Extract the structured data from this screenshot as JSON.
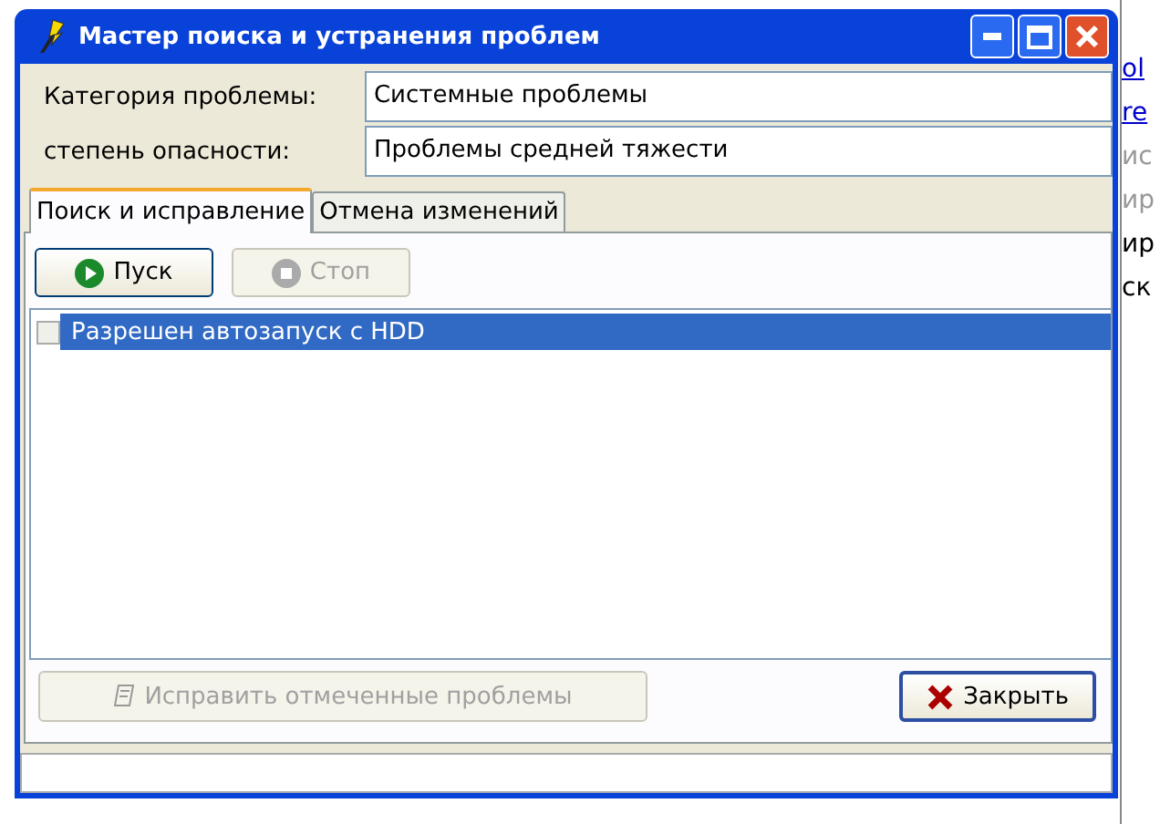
{
  "background": {
    "right_fragments": [
      {
        "text": "ol",
        "kind": "link"
      },
      {
        "text": "re",
        "kind": "link"
      },
      {
        "text": "ис",
        "kind": "grey"
      },
      {
        "text": "ир",
        "kind": "grey"
      },
      {
        "text": "ир",
        "kind": "plain"
      },
      {
        "text": "ск",
        "kind": "plain"
      }
    ]
  },
  "window": {
    "title": "Мастер поиска и устранения проблем"
  },
  "fields": [
    {
      "label": "Категория проблемы:",
      "value": "Системные проблемы"
    },
    {
      "label": "степень опасности:",
      "value": "Проблемы средней тяжести"
    }
  ],
  "tabs": [
    {
      "label": "Поиск и исправление",
      "selected": true
    },
    {
      "label": "Отмена изменений",
      "selected": false
    }
  ],
  "toolbar": [
    {
      "label": "Пуск",
      "kind": "play",
      "disabled": false
    },
    {
      "label": "Стоп",
      "kind": "stop",
      "disabled": true
    }
  ],
  "items": [
    {
      "label": "Разрешен автозапуск с HDD",
      "checked": false,
      "selected": true
    }
  ],
  "buttons": [
    {
      "label": "Исправить отмеченные проблемы",
      "kind": "fix",
      "disabled": true
    },
    {
      "label": "Закрыть",
      "kind": "close",
      "disabled": false
    }
  ]
}
